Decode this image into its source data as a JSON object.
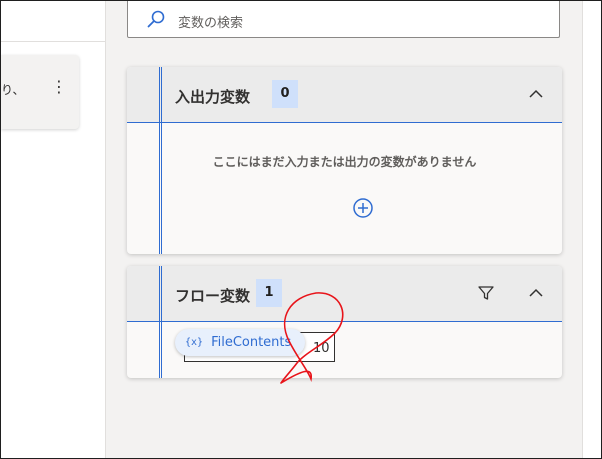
{
  "canvas": {
    "action_text": "り、",
    "more_icon": "more-vertical-icon"
  },
  "search": {
    "placeholder": "変数の検索",
    "icon": "search-icon"
  },
  "io_section": {
    "title": "入出力変数",
    "count": "0",
    "empty_message": "ここにはまだ入力または出力の変数がありません",
    "add_icon": "add-circle-icon",
    "collapse_icon": "chevron-up-icon"
  },
  "flow_section": {
    "title": "フロー変数",
    "count": "1",
    "filter_icon": "filter-icon",
    "collapse_icon": "chevron-up-icon",
    "variable": {
      "icon_text": "{x}",
      "name": "FileContents",
      "value_fragment": "10"
    }
  },
  "colors": {
    "accent": "#2f6cd1",
    "badge_bg": "#cfe0fb",
    "annotation": "#e8141a"
  }
}
